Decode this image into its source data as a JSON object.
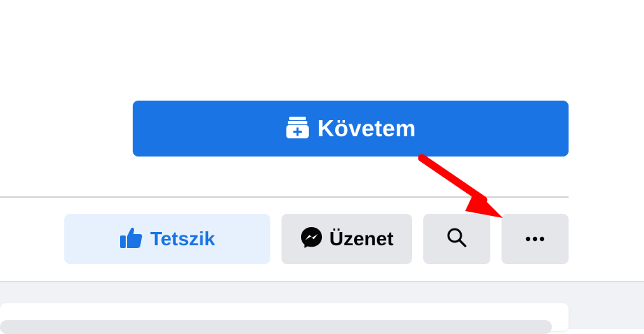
{
  "header": {
    "follow_label": "Követem"
  },
  "actions": {
    "like_label": "Tetszik",
    "message_label": "Üzenet"
  },
  "icons": {
    "follow": "follow-page-icon",
    "like": "thumbs-up-icon",
    "message": "messenger-icon",
    "search": "search-icon",
    "more": "more-dots-icon"
  },
  "colors": {
    "primary": "#1b74e4",
    "like_bg": "#e6f1fd",
    "secondary_bg": "#e4e6ea",
    "annotation": "#ff0000"
  }
}
